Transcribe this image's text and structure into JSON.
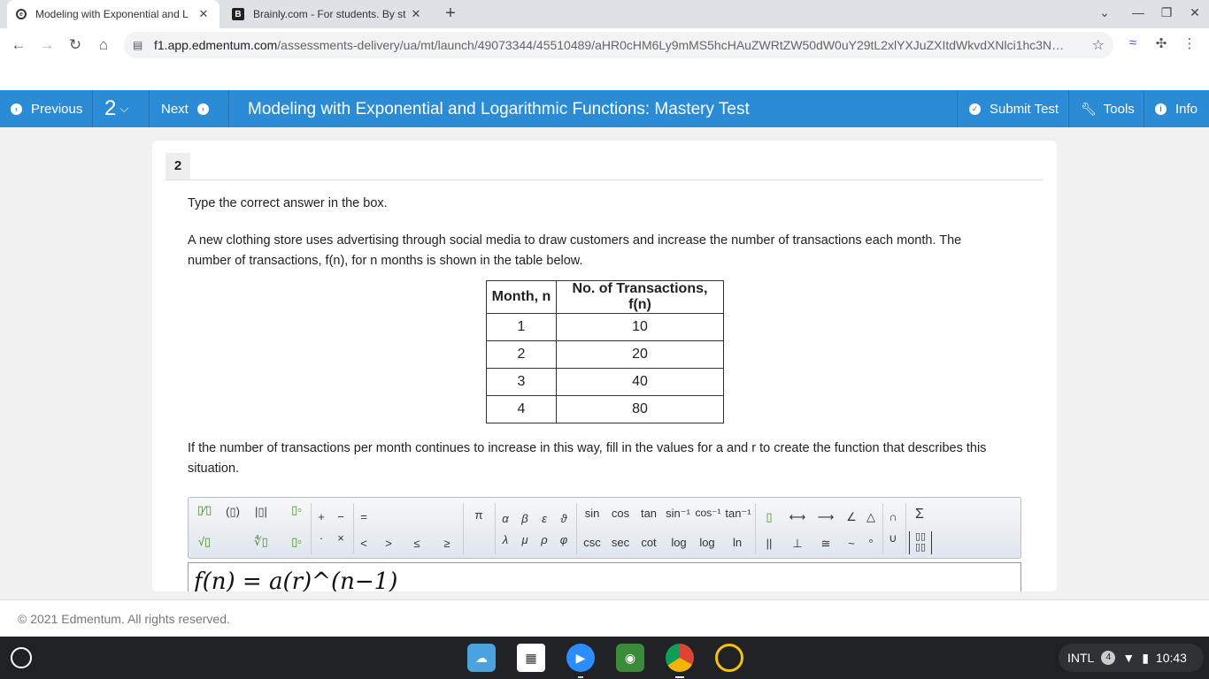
{
  "browser": {
    "tabs": [
      {
        "title": "Modeling with Exponential and L",
        "active": true
      },
      {
        "title": "Brainly.com - For students. By st",
        "active": false
      }
    ],
    "new_tab": "+",
    "url_host": "f1.app.edmentum.com",
    "url_path": "/assessments-delivery/ua/mt/launch/49073344/45510489/aHR0cHM6Ly9mMS5hcHAuZWRtZW50dW0uY29tL2xlYXJuZXItdWkvdXNlci1hc3N…"
  },
  "appbar": {
    "previous_label": "Previous",
    "question_number": "2",
    "next_label": "Next",
    "title": "Modeling with Exponential and Logarithmic Functions: Mastery Test",
    "submit_label": "Submit Test",
    "tools_label": "Tools",
    "info_label": "Info",
    "accent": "#2b8bd4"
  },
  "question": {
    "number": "2",
    "instruction": "Type the correct answer in the box.",
    "paragraph_1a": "A new clothing store uses advertising through social media to draw customers and increase the number of transactions each month. The",
    "paragraph_1b": "number of transactions, f(n), for n months is shown in the table below.",
    "paragraph_2a": "If the number of transactions per month continues to increase in this way, fill in the values for a and r to create the function that describes this",
    "paragraph_2b": "situation.",
    "table": {
      "headers": [
        "Month, n",
        "No. of Transactions, f(n)"
      ],
      "rows": [
        [
          "1",
          "10"
        ],
        [
          "2",
          "20"
        ],
        [
          "3",
          "40"
        ],
        [
          "4",
          "80"
        ]
      ]
    },
    "equation": "f(n) = a(r)^(n−1)"
  },
  "palette": {
    "row1": [
      "π",
      "α",
      "β",
      "ε",
      "ϑ",
      "sin",
      "cos",
      "tan",
      "sin⁻¹",
      "cos⁻¹",
      "tan⁻¹",
      "∠",
      "△",
      "∩",
      "Σ",
      "+",
      "−",
      "="
    ],
    "row2": [
      "λ",
      "μ",
      "ρ",
      "φ",
      "csc",
      "sec",
      "cot",
      "log",
      "log",
      "ln",
      "||",
      "⊥",
      "≅",
      "~",
      "°",
      "∪",
      "·",
      "×",
      "<",
      ">",
      "≤",
      "≥"
    ]
  },
  "footer": {
    "copyright": "© 2021 Edmentum. All rights reserved."
  },
  "taskbar": {
    "locale": "INTL",
    "badge": "4",
    "time": "10:43"
  }
}
